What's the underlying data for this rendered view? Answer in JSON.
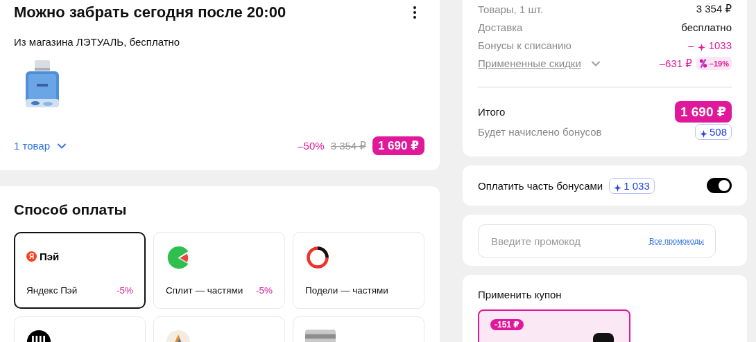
{
  "pickup": {
    "title": "Можно забрать сегодня после 20:00",
    "subtitle": "Из магазина ЛЭТУАЛЬ, бесплатно",
    "items_toggle": {
      "label": "1 товар",
      "expanded": false
    },
    "discount": "–50%",
    "old_price": "3 354 ₽",
    "price": "1 690 ₽"
  },
  "payment": {
    "title": "Способ оплаты",
    "methods": [
      {
        "kind": "yandex",
        "logo_mark": "Я",
        "logo_text": "Пэй",
        "name": "Яндекс Пэй",
        "discount": "-5%",
        "selected": true
      },
      {
        "kind": "split",
        "name": "Сплит — частями",
        "discount": "-5%",
        "selected": false
      },
      {
        "kind": "podeli",
        "name": "Подели — частями",
        "selected": false
      },
      {
        "kind": "sbp",
        "selected": false
      },
      {
        "kind": "wallet",
        "selected": false
      },
      {
        "kind": "card",
        "selected": false
      }
    ]
  },
  "summary": {
    "rows": [
      {
        "kind": "plain",
        "label": "Товары, 1 шт.",
        "value": "3 354 ₽"
      },
      {
        "kind": "plain",
        "label": "Доставка",
        "value": "бесплатно"
      },
      {
        "kind": "bonus",
        "label": "Бонусы к списанию",
        "sign": "–",
        "value": "1033"
      },
      {
        "kind": "discounts",
        "label": "Примененные скидки",
        "expanded": false,
        "value": "–631 ₽",
        "badge": "–19%"
      }
    ],
    "total": {
      "label": "Итого",
      "value": "1 690 ₽"
    },
    "accrual": {
      "label": "Будет начислено бонусов",
      "value": "508"
    }
  },
  "bonus_pay": {
    "label": "Оплатить часть бонусами",
    "amount": "1 033",
    "on": true
  },
  "promo": {
    "placeholder": "Введите промокод",
    "link": "Все промокоды"
  },
  "coupon": {
    "title": "Применить купон",
    "badge": "-151 ₽"
  }
}
